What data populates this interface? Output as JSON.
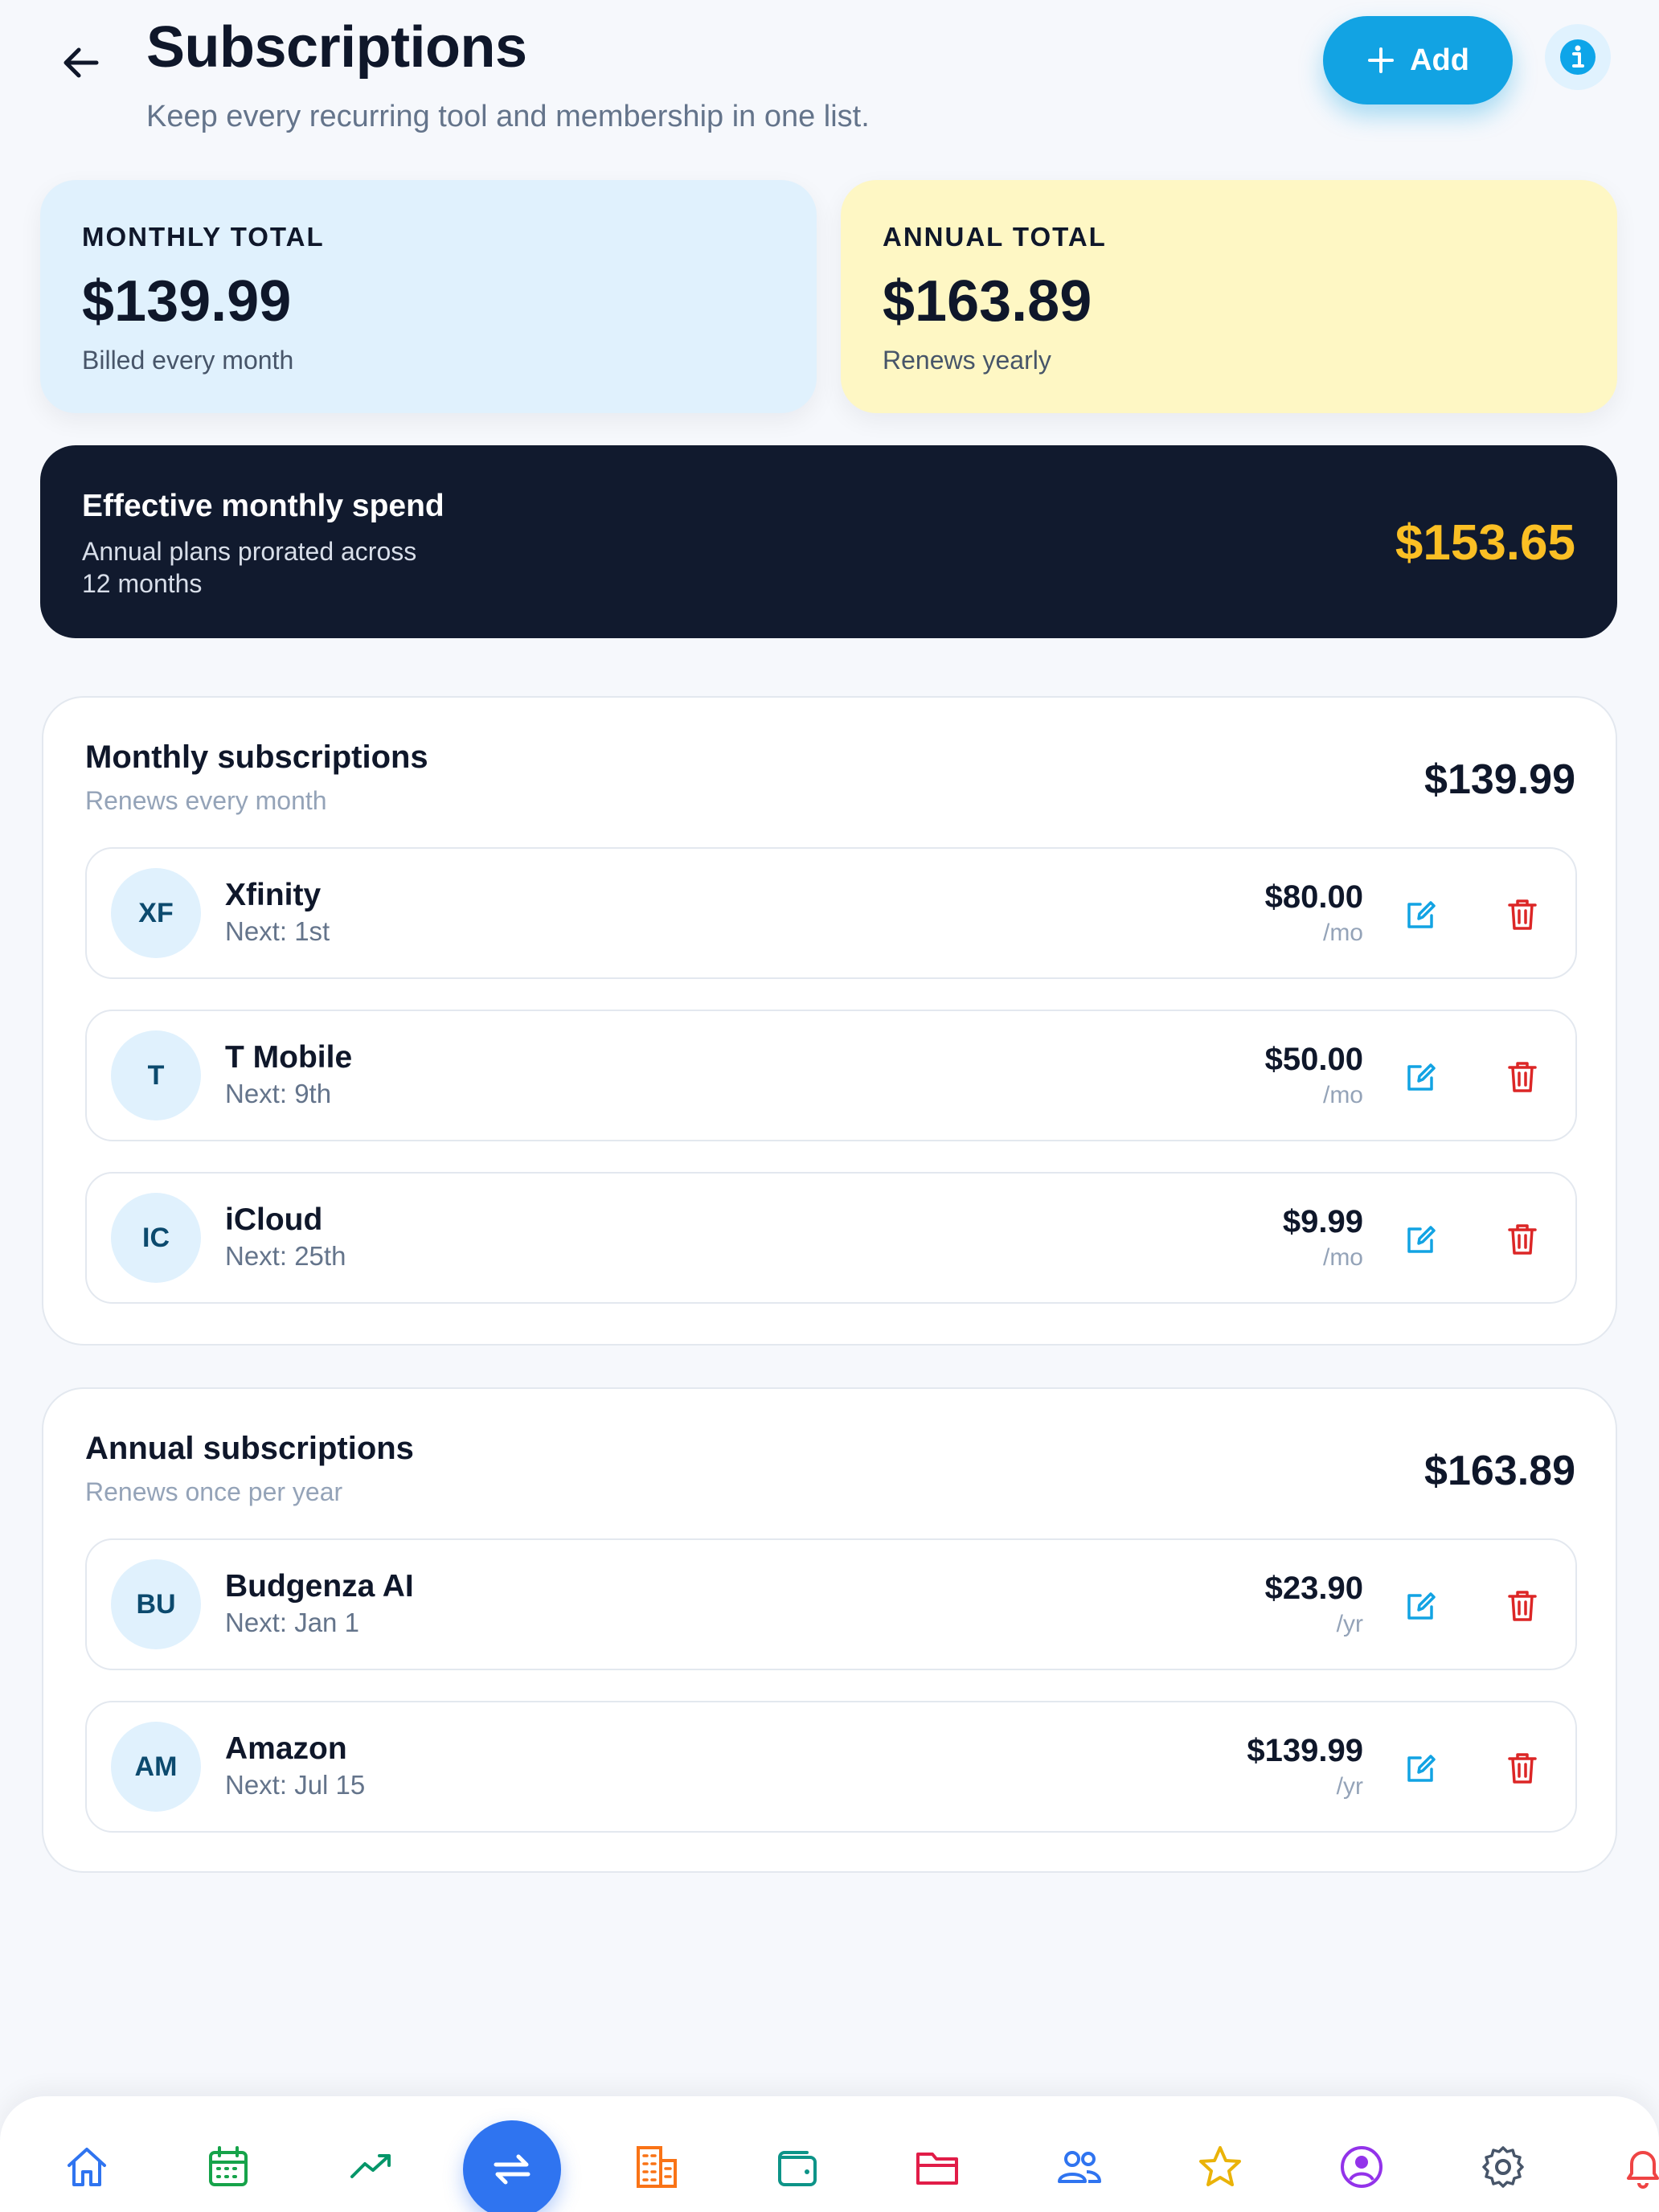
{
  "header": {
    "title": "Subscriptions",
    "subtitle": "Keep every recurring tool and membership in one list.",
    "add_label": "Add"
  },
  "summary": {
    "monthly": {
      "label": "MONTHLY TOTAL",
      "value": "$139.99",
      "note": "Billed every month"
    },
    "annual": {
      "label": "ANNUAL TOTAL",
      "value": "$163.89",
      "note": "Renews yearly"
    }
  },
  "effective": {
    "title": "Effective monthly spend",
    "description": "Annual plans prorated across 12 months",
    "value": "$153.65"
  },
  "monthly_section": {
    "title": "Monthly subscriptions",
    "subtitle": "Renews every month",
    "total": "$139.99",
    "items": [
      {
        "initials": "XF",
        "name": "Xfinity",
        "next": "Next: 1st",
        "amount": "$80.00",
        "period": "/mo"
      },
      {
        "initials": "T",
        "name": "T Mobile",
        "next": "Next: 9th",
        "amount": "$50.00",
        "period": "/mo"
      },
      {
        "initials": "IC",
        "name": "iCloud",
        "next": "Next: 25th",
        "amount": "$9.99",
        "period": "/mo"
      }
    ]
  },
  "annual_section": {
    "title": "Annual subscriptions",
    "subtitle": "Renews once per year",
    "total": "$163.89",
    "items": [
      {
        "initials": "BU",
        "name": "Budgenza AI",
        "next": "Next: Jan 1",
        "amount": "$23.90",
        "period": "/yr"
      },
      {
        "initials": "AM",
        "name": "Amazon",
        "next": "Next: Jul 15",
        "amount": "$139.99",
        "period": "/yr"
      }
    ]
  },
  "nav": {
    "items": [
      "home-icon",
      "calendar-icon",
      "trending-up-icon",
      "transfer-icon",
      "building-icon",
      "wallet-icon",
      "folder-icon",
      "users-icon",
      "star-icon",
      "user-circle-icon",
      "settings-icon",
      "bell-icon"
    ],
    "active": "transfer-icon"
  },
  "colors": {
    "accent": "#12a3e3",
    "nav_active": "#2f74f0",
    "highlight": "#fbbf24",
    "delete": "#dc2626"
  }
}
